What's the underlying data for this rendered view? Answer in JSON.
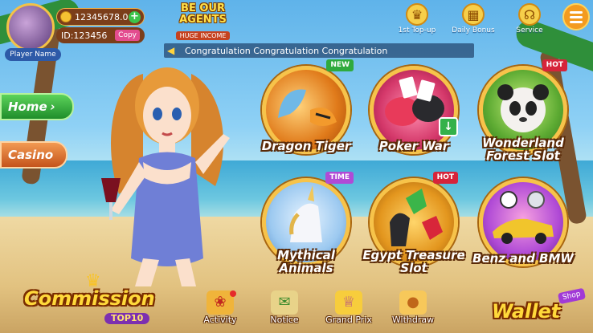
{
  "profile": {
    "player_name": "Player Name",
    "balance": "12345678.0",
    "id_text": "ID:123456",
    "copy_label": "Copy"
  },
  "agents": {
    "title_line1": "BE OUR",
    "title_line2": "AGENTS",
    "subtitle": "HUGE INCOME"
  },
  "top_icons": [
    {
      "label": "1st Top-up",
      "icon": "trophy-icon"
    },
    {
      "label": "Daily Bonus",
      "icon": "calendar-icon"
    },
    {
      "label": "Service",
      "icon": "headset-icon"
    }
  ],
  "marquee": {
    "text": "Congratulation  Congratulation Congratulation"
  },
  "side_tabs": {
    "home": "Home",
    "casino": "Casino"
  },
  "games": [
    {
      "title": "Dragon Tiger",
      "badge": "NEW"
    },
    {
      "title": "Poker War",
      "badge": ""
    },
    {
      "title_line1": "Wonderland",
      "title_line2": "Forest  Slot",
      "badge": "HOT"
    },
    {
      "title_line1": "Mythical",
      "title_line2": "Animals",
      "badge": "TIME"
    },
    {
      "title_line1": "Egypt Treasure",
      "title_line2": "Slot",
      "badge": "HOT"
    },
    {
      "title": "Benz and BMW",
      "badge": ""
    }
  ],
  "bottom": {
    "commission": "Commission",
    "commission_sub": "TOP10",
    "nav": [
      {
        "label": "Activity",
        "icon": "gift-icon"
      },
      {
        "label": "Notice",
        "icon": "scroll-icon"
      },
      {
        "label": "Grand Prix",
        "icon": "cup-icon"
      },
      {
        "label": "Withdraw",
        "icon": "piggy-bank-icon"
      }
    ],
    "wallet": "Wallet",
    "shop": "Shop"
  },
  "colors": {
    "gold": "#f7c34a",
    "badge_new": "#2faa3d",
    "badge_hot": "#d6243a",
    "badge_time": "#b04ad6"
  }
}
